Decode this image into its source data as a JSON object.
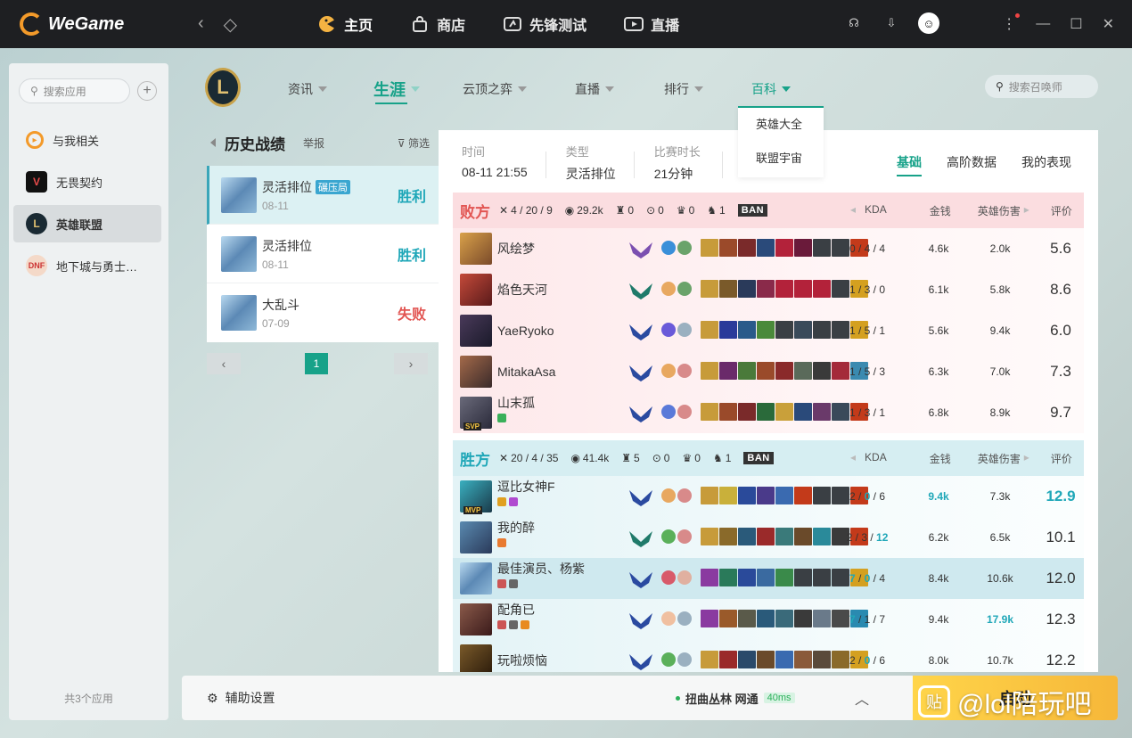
{
  "app": {
    "brand": "WeGame"
  },
  "topnav": [
    {
      "label": "主页",
      "icon": "pacman-icon"
    },
    {
      "label": "商店",
      "icon": "shop-bag-icon"
    },
    {
      "label": "先锋测试",
      "icon": "test-icon"
    },
    {
      "label": "直播",
      "icon": "play-icon"
    }
  ],
  "sidebar": {
    "search_placeholder": "搜索应用",
    "items": [
      {
        "label": "与我相关",
        "icon": "related-icon",
        "color": "#f39a2a"
      },
      {
        "label": "无畏契约",
        "icon": "valorant-icon",
        "color": "#e84a4a"
      },
      {
        "label": "英雄联盟",
        "icon": "lol-icon",
        "color": "#c8a24a"
      },
      {
        "label": "地下城与勇士…",
        "icon": "dnf-icon",
        "color": "#d55"
      }
    ],
    "footer": "共3个应用"
  },
  "lol": {
    "logo": "L",
    "tabs": [
      {
        "label": "资讯"
      },
      {
        "label": "生涯"
      },
      {
        "label": "云顶之弈"
      },
      {
        "label": "直播"
      },
      {
        "label": "排行"
      },
      {
        "label": "百科"
      }
    ],
    "dropdown": [
      "英雄大全",
      "联盟宇宙"
    ],
    "summoner_search_placeholder": "搜索召唤师"
  },
  "history": {
    "title": "历史战绩",
    "report": "举报",
    "filter": "筛选",
    "matches": [
      {
        "mode": "灵活排位",
        "tag": "碾压局",
        "date": "08-11",
        "result": "胜利"
      },
      {
        "mode": "灵活排位",
        "tag": "",
        "date": "08-11",
        "result": "胜利"
      },
      {
        "mode": "大乱斗",
        "tag": "",
        "date": "07-09",
        "result": "失败"
      }
    ],
    "page": "1"
  },
  "detail": {
    "info": [
      {
        "label": "时间",
        "value": "08-11 21:55"
      },
      {
        "label": "类型",
        "value": "灵活排位"
      },
      {
        "label": "比赛时长",
        "value": "21分钟"
      }
    ],
    "sub_tabs": [
      "基础",
      "高阶数据",
      "我的表现"
    ],
    "columns": {
      "kda": "KDA",
      "gold": "金钱",
      "damage": "英雄伤害",
      "score": "评价"
    },
    "teams": [
      {
        "name": "败方",
        "kda": "4 / 20 / 9",
        "gold": "29.2k",
        "towers": "0",
        "dragons": "0",
        "barons": "0",
        "heralds": "1",
        "ban": "BAN",
        "players": [
          {
            "name": "风绘梦",
            "kda": "0 / 4 / 4",
            "gold": "4.6k",
            "damage": "2.0k",
            "score": "5.6",
            "badge": ""
          },
          {
            "name": "焰色天河",
            "kda": "1 / 3 / 0",
            "gold": "6.1k",
            "damage": "5.8k",
            "score": "8.6",
            "badge": ""
          },
          {
            "name": "YaeRyoko",
            "kda": "1 / 5 / 1",
            "gold": "5.6k",
            "damage": "9.4k",
            "score": "6.0",
            "badge": ""
          },
          {
            "name": "MitakaAsa",
            "kda": "1 / 5 / 3",
            "gold": "6.3k",
            "damage": "7.0k",
            "score": "7.3",
            "badge": ""
          },
          {
            "name": "山末孤",
            "kda": "1 / 3 / 1",
            "gold": "6.8k",
            "damage": "8.9k",
            "score": "9.7",
            "badge": "SVP"
          }
        ]
      },
      {
        "name": "胜方",
        "kda": "20 / 4 / 35",
        "gold": "41.4k",
        "towers": "5",
        "dragons": "0",
        "barons": "0",
        "heralds": "1",
        "ban": "BAN",
        "players": [
          {
            "name": "逗比女神F",
            "kda_k": "2",
            "kda_d": "0",
            "kda_a": "6",
            "gold": "9.4k",
            "damage": "7.3k",
            "score": "12.9",
            "badge": "MVP"
          },
          {
            "name": "我的醉",
            "kda_k": "2",
            "kda_d": "3",
            "kda_a": "12",
            "gold": "6.2k",
            "damage": "6.5k",
            "score": "10.1",
            "badge": ""
          },
          {
            "name": "最佳演员、杨紫",
            "kda_k": "7",
            "kda_d": "0",
            "kda_a": "4",
            "gold": "8.4k",
            "damage": "10.6k",
            "score": "12.0",
            "badge": ""
          },
          {
            "name": "配角已",
            "kda_k": "7",
            "kda_d": "1",
            "kda_a": "7",
            "gold": "9.4k",
            "damage": "17.9k",
            "score": "12.3",
            "badge": ""
          },
          {
            "name": "玩啦烦恼",
            "kda_k": "2",
            "kda_d": "0",
            "kda_a": "6",
            "gold": "8.0k",
            "damage": "10.7k",
            "score": "12.2",
            "badge": ""
          }
        ]
      }
    ]
  },
  "bottom": {
    "assist": "辅助设置",
    "server": "扭曲丛林 网通",
    "ping": "40ms",
    "launch": "启动"
  },
  "watermark": {
    "icon_text": "贴",
    "text": "@lol陪玩吧"
  }
}
